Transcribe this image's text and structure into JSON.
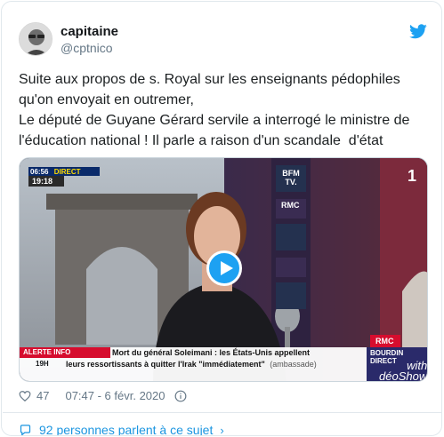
{
  "author": {
    "display_name": "capitaine",
    "handle": "@cptnico"
  },
  "tweet": {
    "lines": [
      "Suite aux propos de s. Royal sur les enseignants pédophiles",
      "qu'on envoyait en outremer,",
      "Le député de Guyane Gérard servile a interrogé le ministre de",
      "l'éducation national ! Il parle a raison d'un scandale  d'état"
    ]
  },
  "video": {
    "channel_logo": "BFM TV.",
    "clock": "06:56",
    "direct_label": "DIRECT",
    "time_badge": "19:18",
    "rmc_label": "RMC",
    "ticker_badge": "ALERTE INFO",
    "ticker_time": "19H",
    "ticker_line1": "Mort du général Soleimani : les États-Unis appellent",
    "ticker_line2": "leurs ressortissants à quitter l'Irak \"immédiatement\"",
    "ticker_source": "(ambassade)",
    "show_line1": "BOURDIN",
    "show_line2": "DIRECT",
    "show_line3": "with",
    "show_line4": "déoShow",
    "corner_mark": "1"
  },
  "footer": {
    "likes": "47",
    "timestamp": "07:47 - 6 févr. 2020",
    "conversation": "92 personnes parlent à ce sujet"
  },
  "colors": {
    "accent": "#1da1f2",
    "link": "#1b95e0",
    "muted": "#657786"
  },
  "icons": [
    "twitter-bird-icon",
    "play-icon",
    "heart-icon",
    "info-icon",
    "comment-bubble-icon",
    "chevron-right-icon"
  ]
}
